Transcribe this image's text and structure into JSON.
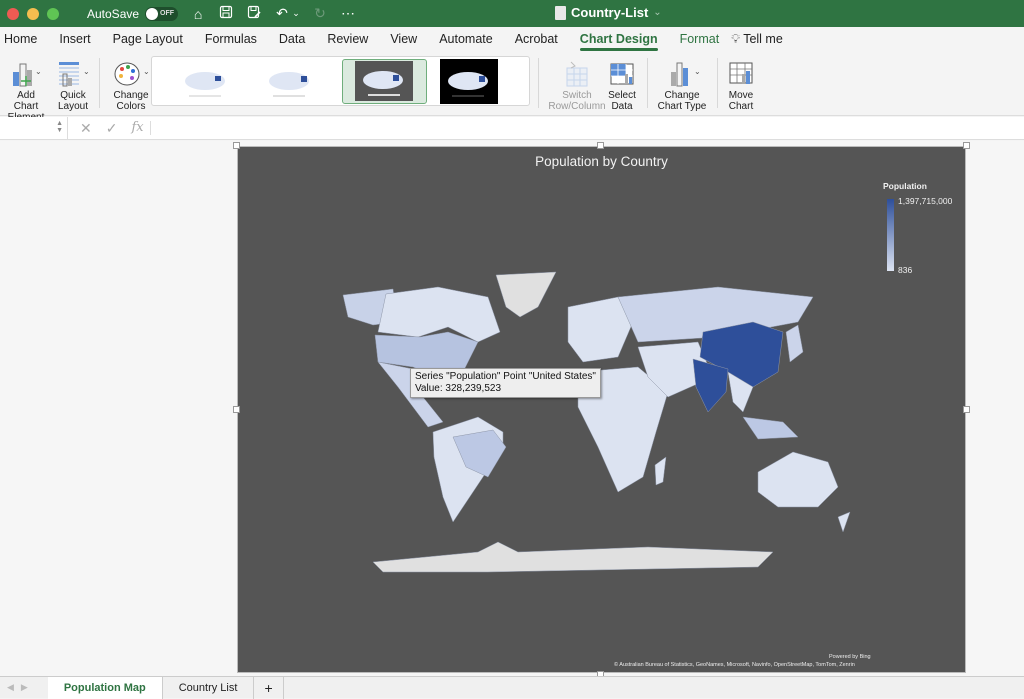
{
  "titlebar": {
    "autosave_label": "AutoSave",
    "autosave_state": "OFF",
    "document_title": "Country-List",
    "icons": [
      "home-icon",
      "save-icon",
      "save-as-icon",
      "undo-icon",
      "undo-dropdown-icon",
      "redo-icon",
      "more-icon"
    ]
  },
  "tabs": [
    {
      "label": "Home"
    },
    {
      "label": "Insert"
    },
    {
      "label": "Page Layout"
    },
    {
      "label": "Formulas"
    },
    {
      "label": "Data"
    },
    {
      "label": "Review"
    },
    {
      "label": "View"
    },
    {
      "label": "Automate"
    },
    {
      "label": "Acrobat"
    },
    {
      "label": "Chart Design",
      "active": true
    },
    {
      "label": "Format"
    },
    {
      "label": "Tell me"
    }
  ],
  "ribbon": {
    "add_chart_element": "Add Chart Element",
    "add_chart_element_l1": "Add Chart",
    "add_chart_element_l2": "Element",
    "quick_layout_l1": "Quick",
    "quick_layout_l2": "Layout",
    "change_colors_l1": "Change",
    "change_colors_l2": "Colors",
    "switch_l1": "Switch",
    "switch_l2": "Row/Column",
    "select_data_l1": "Select",
    "select_data_l2": "Data",
    "change_type_l1": "Change",
    "change_type_l2": "Chart Type",
    "move_chart_l1": "Move",
    "move_chart_l2": "Chart",
    "chart_styles_selected": 3
  },
  "formula_bar": {
    "name_box": "",
    "formula": "",
    "fx_label": "fx"
  },
  "chart": {
    "title": "Population by Country",
    "legend_title": "Population",
    "legend_max": "1,397,715,000",
    "legend_min": "836",
    "tooltip_line1": "Series \"Population\" Point \"United States\"",
    "tooltip_line2": "Value: 328,239,523",
    "powered_by": "Powered by Bing",
    "attribution": "© Australian Bureau of Statistics, GeoNames, Microsoft, Navinfo, OpenStreetMap, TomTom, Zenrin",
    "colors": {
      "background": "#555555",
      "high": "#2e4f9a",
      "low": "#dde4f2",
      "no_data": "#e0e0e0"
    }
  },
  "chart_data": {
    "type": "heatmap",
    "subtype": "filled-map",
    "title": "Population by Country",
    "series": "Population",
    "color_scale": {
      "min": 836,
      "max": 1397715000,
      "min_label": "836",
      "max_label": "1,397,715,000"
    },
    "highlighted_points": [
      {
        "country": "United States",
        "value": 328239523
      },
      {
        "country": "China",
        "shade": "high"
      },
      {
        "country": "India",
        "shade": "high"
      },
      {
        "country": "Brazil",
        "shade": "medium-low"
      },
      {
        "country": "Indonesia",
        "shade": "medium-low"
      }
    ],
    "legend": "top-right"
  },
  "sheet_tabs": [
    {
      "label": "Population Map",
      "active": true
    },
    {
      "label": "Country List"
    }
  ],
  "add_sheet_label": "+"
}
